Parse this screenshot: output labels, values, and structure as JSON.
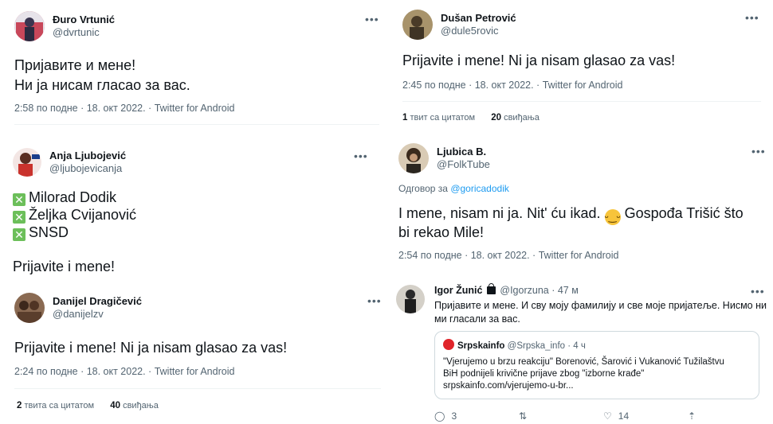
{
  "tweets": [
    {
      "name": "Đuro Vrtunić",
      "handle": "@dvrtunic",
      "text_lines": [
        "Пријавите и мене!",
        "Ни ја нисам гласао за вас."
      ],
      "meta": "2:58 по подне · 18. окт 2022. · Twitter for Android",
      "avatar_color": "#c8475a"
    },
    {
      "name": "Dušan Petrović",
      "handle": "@dule5rovic",
      "text": "Prijavite i mene! Ni ja nisam glasao za vas!",
      "meta": "2:45 по подне · 18. окт 2022. · Twitter for Android",
      "stat1_num": "1",
      "stat1_label": "твит са цитатом",
      "stat2_num": "20",
      "stat2_label": "свиђања",
      "avatar_color": "#6b5a3b"
    },
    {
      "name": "Anja Ljubojević",
      "handle": "@ljubojevicanja",
      "list": [
        "Milorad Dodik",
        "Željka Cvijanović",
        "SNSD"
      ],
      "text": "Prijavite i mene!",
      "avatar_color": "#b9423c"
    },
    {
      "name": "Ljubica B.",
      "handle": "@FolkTube",
      "reply_prefix": "Одговор за",
      "reply_handle": "@goricadodik",
      "text_line1_a": "I mene, nisam ni ja. Nit' ću ikad.",
      "text_line1_b": "Gospođa Trišić što",
      "text_line2": "bi rekao Mile!",
      "emoji": "😁",
      "meta": "2:54 по подне · 18. окт 2022. · Twitter for Android",
      "avatar_color": "#5a4a36"
    },
    {
      "name": "Danijel Dragičević",
      "handle": "@danijelzv",
      "text": "Prijavite i mene! Ni ja nisam glasao za vas!",
      "meta": "2:24 по подне · 18. окт 2022. · Twitter for Android",
      "stat1_num": "2",
      "stat1_label": "твита са цитатом",
      "stat2_num": "40",
      "stat2_label": "свиђања",
      "avatar_color": "#7a4f3a"
    },
    {
      "name": "Igor Žunić",
      "handle": "@Igorzuna",
      "time": "· 47 м",
      "text_line1": "Пријавите и мене. И сву моју фамилију и све моје пријатеље. Нисмо ни",
      "text_line2": "ми гласали за вас.",
      "quote": {
        "name": "Srpskainfo",
        "handle": "@Srpska_info",
        "time": "· 4 ч",
        "line1": "\"Vjerujemo u brzu reakciju\" Borenović, Šarović i Vukanović Tužilaštvu",
        "line2": "BiH podnijeli krivične prijave zbog \"izborne krađe\"",
        "line3": "srpskainfo.com/vjerujemo-u-br..."
      },
      "reply_count": "3",
      "like_count": "14",
      "avatar_color": "#3b3b3b"
    }
  ],
  "more_icon": "•••"
}
